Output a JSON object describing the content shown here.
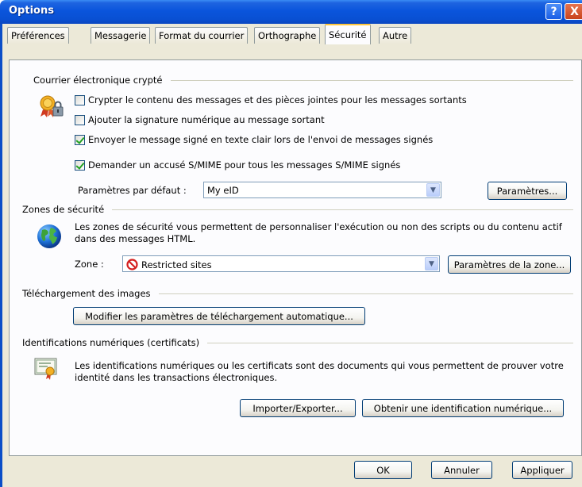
{
  "window": {
    "title": "Options",
    "help_glyph": "?",
    "close_glyph": "X"
  },
  "tabs": [
    {
      "label": "Préférences",
      "active": false
    },
    {
      "label": "Messagerie",
      "active": false
    },
    {
      "label": "Format du courrier",
      "active": false
    },
    {
      "label": "Orthographe",
      "active": false
    },
    {
      "label": "Sécurité",
      "active": true
    },
    {
      "label": "Autre",
      "active": false
    }
  ],
  "encrypted_mail": {
    "heading": "Courrier électronique crypté",
    "icon": "certificate-lock-icon",
    "options": [
      {
        "label": "Crypter le contenu des messages et des pièces jointes pour les messages sortants",
        "checked": false
      },
      {
        "label": "Ajouter la signature numérique au message sortant",
        "checked": false
      },
      {
        "label": "Envoyer le message signé en texte clair lors de l'envoi de messages signés",
        "checked": true
      },
      {
        "label": "Demander un accusé S/MIME pour tous les messages S/MIME signés",
        "checked": true
      }
    ],
    "default_settings_label": "Paramètres par défaut :",
    "default_settings_value": "My eID",
    "settings_button": "Paramètres..."
  },
  "security_zones": {
    "heading": "Zones de sécurité",
    "icon": "globe-icon",
    "description": "Les zones de sécurité vous permettent de personnaliser l'exécution ou non des scripts ou du contenu actif dans des messages HTML.",
    "zone_label": "Zone :",
    "zone_value": "Restricted sites",
    "zone_settings_button": "Paramètres de la zone..."
  },
  "image_download": {
    "heading": "Téléchargement des images",
    "button": "Modifier les paramètres de téléchargement automatique..."
  },
  "digital_ids": {
    "heading": "Identifications numériques (certificats)",
    "icon": "certificate-icon",
    "description": "Les identifications numériques ou les certificats sont des documents qui vous permettent de prouver votre identité dans les transactions électroniques.",
    "import_export_button": "Importer/Exporter...",
    "get_id_button": "Obtenir une identification numérique..."
  },
  "footer": {
    "ok": "OK",
    "cancel": "Annuler",
    "apply": "Appliquer"
  },
  "colors": {
    "titlebar": "#0a55dc",
    "dialog_bg": "#ece9d8",
    "panel_bg": "#fcfcfe",
    "active_tab_accent": "#ffc73c",
    "check_green": "#21a121"
  }
}
